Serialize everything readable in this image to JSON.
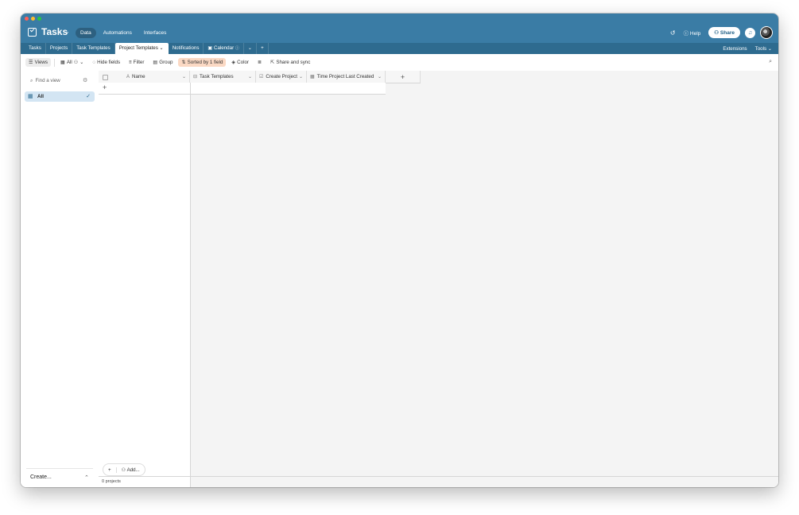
{
  "app": {
    "title": "Tasks",
    "nav": [
      "Data",
      "Automations",
      "Interfaces"
    ],
    "help_label": "Help",
    "share_label": "Share",
    "accent_color": "#3a7ca5"
  },
  "tabs": {
    "items": [
      "Tasks",
      "Projects",
      "Task Templates",
      "Project Templates",
      "Notifications",
      "Calendar"
    ],
    "active": "Project Templates",
    "right": [
      "Extensions",
      "Tools"
    ]
  },
  "toolbar": {
    "views_label": "Views",
    "view_name": "All",
    "hide_fields": "Hide fields",
    "filter": "Filter",
    "group": "Group",
    "sorted": "Sorted by 1 field",
    "color": "Color",
    "share_sync": "Share and sync"
  },
  "sidebar": {
    "find_placeholder": "Find a view",
    "view_item": "All",
    "create_label": "Create..."
  },
  "grid": {
    "columns": [
      {
        "name": "Name",
        "icon": "A"
      },
      {
        "name": "Task Templates",
        "icon": "link-icon"
      },
      {
        "name": "Create Project",
        "icon": "checkbox-icon"
      },
      {
        "name": "Time Project Last Created",
        "icon": "calendar-icon"
      }
    ],
    "add_label": "Add...",
    "record_count": "0 projects"
  }
}
